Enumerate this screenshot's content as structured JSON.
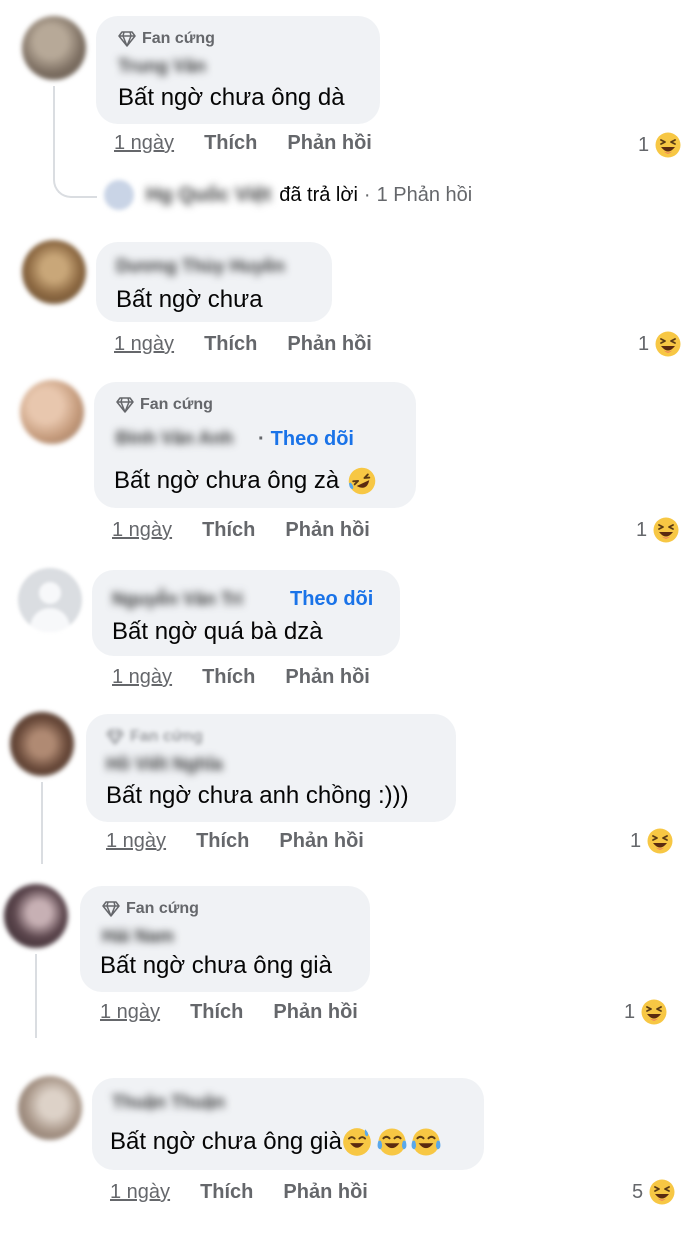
{
  "common": {
    "time": "1 ngày",
    "like": "Thích",
    "reply": "Phản hồi"
  },
  "comments": [
    {
      "badge": "Fan cứng",
      "author": "Trung Văn",
      "text": "Bất ngờ chưa ông dà",
      "reactions": "1",
      "reaction_icon": "laughing-emoji",
      "thread": true,
      "reply_summary": {
        "author": "Hg Quốc Việt",
        "action": "đã trả lời",
        "count": "1 Phản hồi"
      }
    },
    {
      "author": "Dương Thùy Huyền",
      "text": "Bất ngờ chưa",
      "reactions": "1",
      "reaction_icon": "laughing-emoji"
    },
    {
      "badge": "Fan cứng",
      "author": "Đinh Văn Anh",
      "follow": "Theo dõi",
      "text": "Bất ngờ chưa ông zà",
      "text_emoji": "rolling-laughing-emoji",
      "reactions": "1",
      "reaction_icon": "laughing-emoji"
    },
    {
      "author": "Nguyễn Văn Tri",
      "follow": "Theo dõi",
      "text": "Bất ngờ quá bà dzà",
      "reactions": "1",
      "reaction_icon": "laughing-emoji",
      "default_avatar": true
    },
    {
      "badge": "Fan cứng",
      "author": "Hồ Viết Nghĩa",
      "text": "Bất ngờ chưa anh chồng :)))",
      "reactions": "1",
      "reaction_icon": "laughing-emoji",
      "thread": true
    },
    {
      "badge": "Fan cứng",
      "author": "Hải Nam",
      "text": "Bất ngờ chưa ông già",
      "reactions": "1",
      "reaction_icon": "laughing-emoji",
      "thread": true
    },
    {
      "author": "Thuận Thuận",
      "text": "Bất ngờ chưa ông già",
      "text_emojis": [
        "sweat-smile-emoji",
        "tears-of-joy-emoji",
        "tears-of-joy-emoji"
      ],
      "reactions": "5",
      "reaction_icon": "laughing-emoji"
    }
  ],
  "colors": {
    "bubble": "#f0f2f5",
    "link": "#1a73e8",
    "secondary": "#65676b",
    "emoji": "#f7c744"
  }
}
